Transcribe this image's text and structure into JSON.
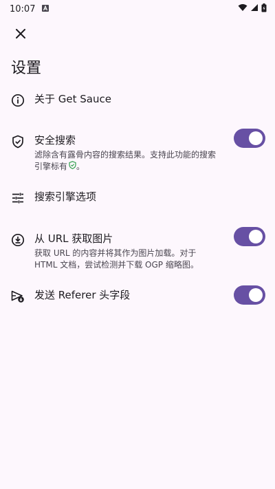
{
  "status_bar": {
    "time": "10:07"
  },
  "title": "设置",
  "settings": [
    {
      "title": "关于 Get Sauce",
      "icon": "info-icon"
    },
    {
      "title": "安全搜索",
      "description": "滤除含有露骨内容的搜索结果。支持此功能的搜索引擎标有",
      "icon": "shield-check-icon",
      "toggle_on": true
    },
    {
      "title": "搜索引擎选项",
      "icon": "tune-sliders-icon"
    },
    {
      "title": "从 URL 获取图片",
      "description": "获取 URL 的内容并将其作为图片加载。对于 HTML 文档，尝试检测并下载 OGP 缩略图。",
      "icon": "download-circle-icon",
      "toggle_on": true
    },
    {
      "title": "发送 Referer 头字段",
      "icon": "send-download-icon",
      "toggle_on": true
    }
  ],
  "colors": {
    "background": "#fdf7fd",
    "accent": "#6750a4",
    "shield_badge": "#2e9e4a"
  }
}
